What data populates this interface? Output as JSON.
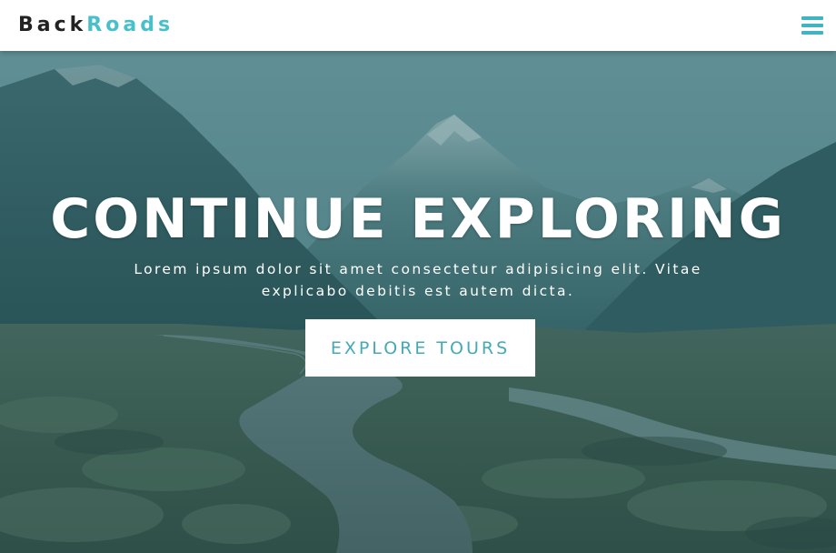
{
  "navbar": {
    "logo_part1": "Back",
    "logo_part2": "Roads",
    "menu_icon": "hamburger-menu-icon"
  },
  "hero": {
    "title": "CONTINUE EXPLORING",
    "text": "Lorem ipsum dolor sit amet consectetur adipisicing elit. Vitae explicabo debitis est autem dicta.",
    "button_label": "EXPLORE TOURS",
    "background_image": "mountain-valley-boardwalk"
  },
  "colors": {
    "accent": "#48c0cc",
    "button_text": "#45aab5",
    "logo_dark": "#222222",
    "overlay": "rgba(30, 90, 98, 0.42)"
  }
}
